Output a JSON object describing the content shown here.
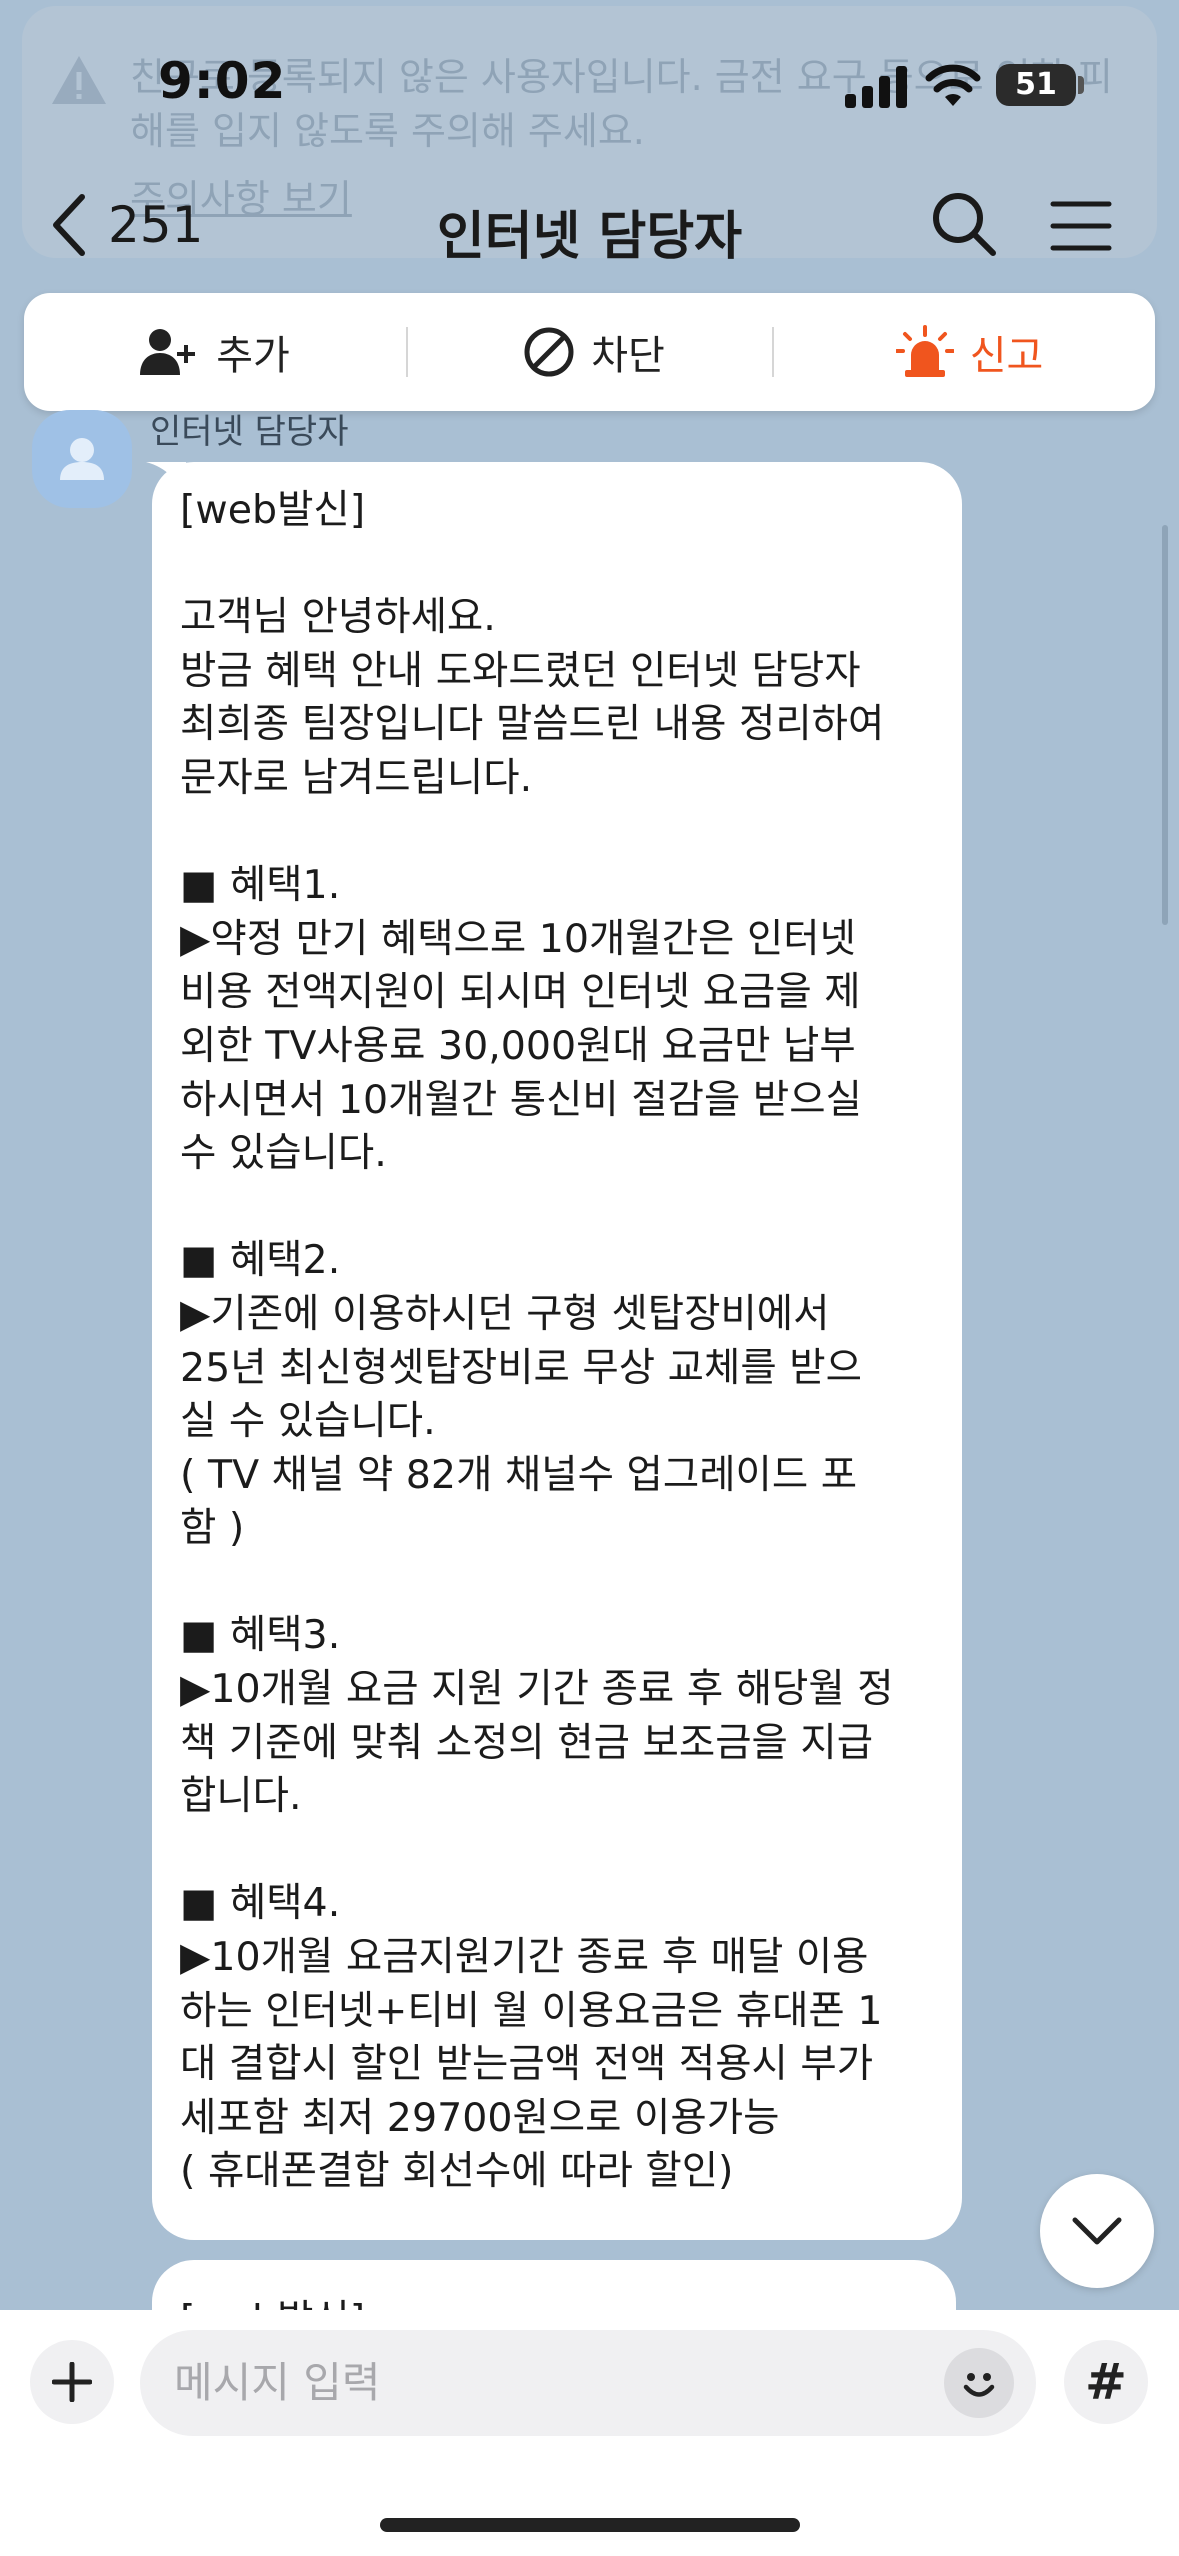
{
  "status_bar": {
    "time": "9:02",
    "battery": "51"
  },
  "warning": {
    "text": "친구로 등록되지 않은 사용자입니다. 금전 요구 등으로 인한 피해를 입지 않도록 주의해 주세요.",
    "link": "주의사항 보기"
  },
  "header": {
    "back_count": "251",
    "title": "인터넷 담당자"
  },
  "actions": {
    "add": "추가",
    "block": "차단",
    "report": "신고"
  },
  "colors": {
    "background": "#a9bfd3",
    "report_accent": "#f0551e"
  },
  "message": {
    "sender": "인터넷 담당자",
    "text": "[web발신]\n\n고객님 안녕하세요.\n방금 혜택 안내 도와드렸던 인터넷 담당자\n최희종 팀장입니다 말씀드린 내용 정리하여\n문자로 남겨드립니다.\n\n■ 혜택1.\n▶약정 만기 혜택으로 10개월간은 인터넷\n비용 전액지원이 되시며 인터넷 요금을 제\n외한 TV사용료 30,000원대 요금만 납부\n하시면서 10개월간 통신비 절감을 받으실\n수 있습니다.\n\n■ 혜택2.\n▶기존에 이용하시던 구형 셋탑장비에서\n25년 최신형셋탑장비로 무상 교체를 받으\n실 수 있습니다.\n( TV 채널 약 82개 채널수 업그레이드 포\n함 )\n\n■ 혜택3.\n▶10개월 요금 지원 기간 종료 후 해당월 정\n책 기준에 맞춰 소정의 현금 보조금을 지급\n합니다.\n\n■ 혜택4.\n▶10개월 요금지원기간 종료 후 매달 이용\n하는 인터넷+티비 월 이용요금은 휴대폰 1\n대 결합시 할인 받는금액 전액 적용시 부가\n세포함 최저 29700원으로 이용가능\n( 휴대폰결합 회선수에 따라 할인)",
    "next_preview": "[web발신]"
  },
  "input": {
    "placeholder": "메시지 입력",
    "hash": "#"
  }
}
